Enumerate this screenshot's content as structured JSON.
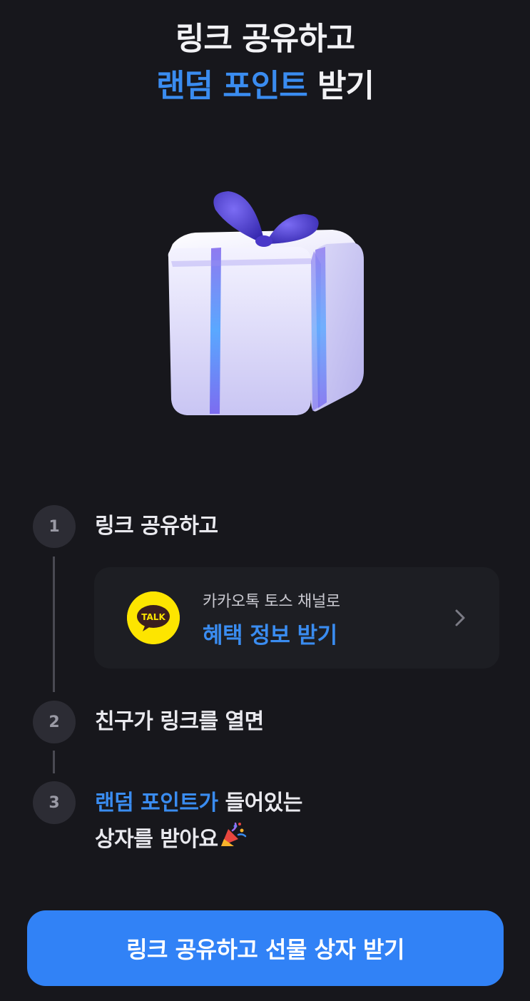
{
  "headline": {
    "line1": "링크 공유하고",
    "line2_accent": "랜덤 포인트",
    "line2_rest": " 받기"
  },
  "steps": [
    {
      "number": "1",
      "text": "링크 공유하고"
    },
    {
      "number": "2",
      "text": "친구가 링크를 열면"
    },
    {
      "number": "3",
      "text_accent": "랜덤 포인트가",
      "text_rest": " 들어있는",
      "text_line2": "상자를 받아요"
    }
  ],
  "kakao_card": {
    "icon_label": "TALK",
    "subtitle": "카카오톡 토스 채널로",
    "title": "혜택 정보 받기"
  },
  "cta": {
    "label": "링크 공유하고 선물 상자 받기"
  },
  "colors": {
    "background": "#17171c",
    "accent": "#3a8cf0",
    "button": "#3182f6",
    "kakao_yellow": "#fde500"
  },
  "icons": {
    "gift": "gift-box-illustration",
    "kakao": "kakaotalk-icon",
    "chevron": "chevron-right-icon",
    "emoji": "party-popper-icon"
  }
}
